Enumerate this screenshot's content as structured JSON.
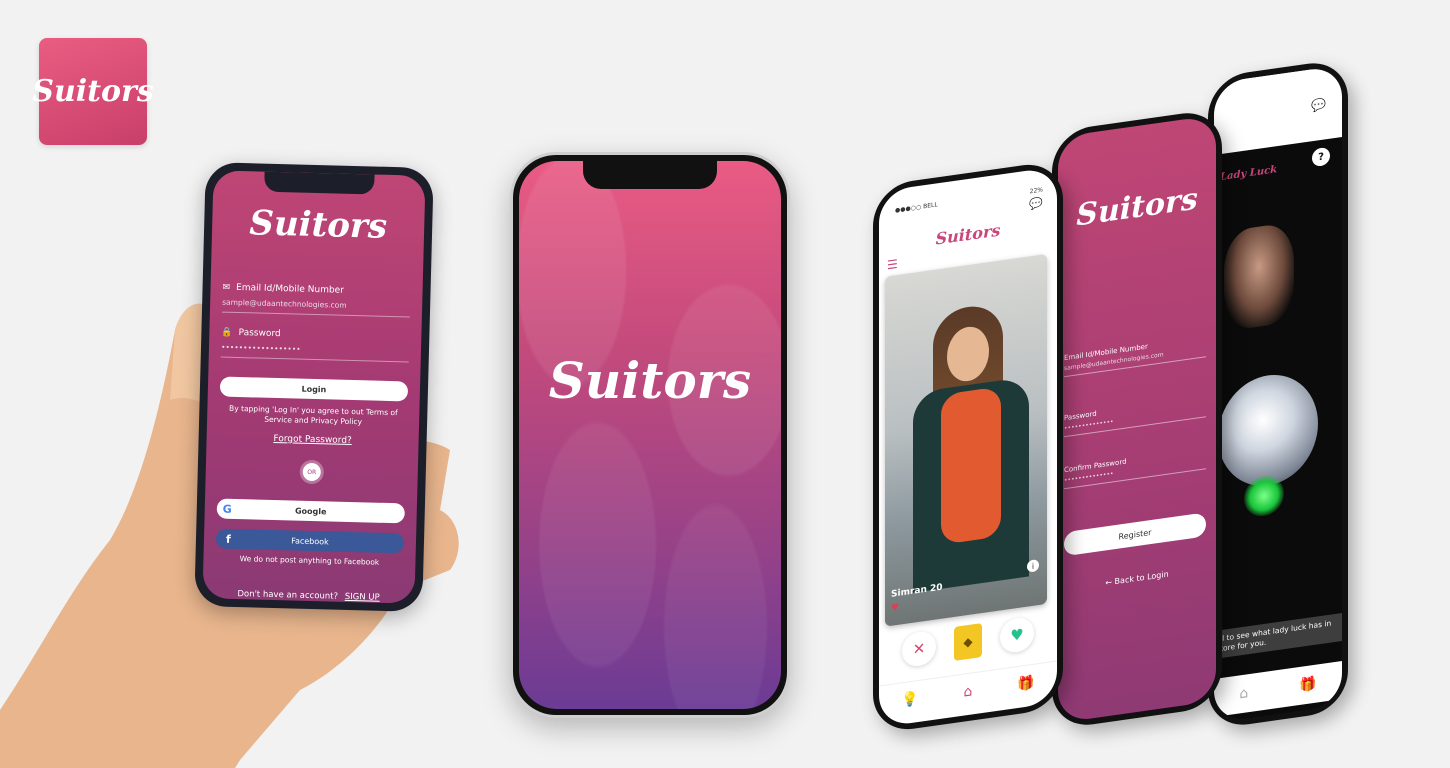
{
  "app_icon": {
    "label": "Suitors"
  },
  "login_screen": {
    "title": "Suitors",
    "email_label": "Email Id/Mobile Number",
    "email_value": "sample@udaantechnologies.com",
    "password_label": "Password",
    "password_value": "••••••••••••••••••",
    "login_button": "Login",
    "terms_text": "By tapping 'Log In' you agree to out Terms of Service and Privacy Policy",
    "forgot_password": "Forgot Password?",
    "or_text": "OR",
    "google_button": "Google",
    "facebook_button": "Facebook",
    "facebook_note": "We do not post anything to Facebook",
    "signup_prompt": "Don't have an account?",
    "signup_link": "SIGN UP"
  },
  "splash_screen": {
    "title": "Suitors"
  },
  "discover_screen": {
    "carrier": "●●●○○ BELL",
    "battery": "22%",
    "header": "Suitors",
    "profile_name": "Simran 20",
    "info_icon": "i"
  },
  "register_screen": {
    "title": "Suitors",
    "email_label": "Email Id/Mobile Number",
    "email_value": "sample@udaantechnologies.com",
    "password_label": "Password",
    "password_value": "••••••••••••••",
    "confirm_label": "Confirm Password",
    "confirm_value": "••••••••••••••",
    "register_button": "Register",
    "back_link": "← Back to Login"
  },
  "lady_luck_screen": {
    "brand": "Lady Luck",
    "help_icon": "?",
    "caption": "ll to see what lady luck has in tore for you."
  },
  "colors": {
    "brand_pink": "#c9467a",
    "gradient_top": "#e95b84",
    "gradient_bottom": "#6b3b95",
    "facebook_blue": "#3b5898"
  }
}
